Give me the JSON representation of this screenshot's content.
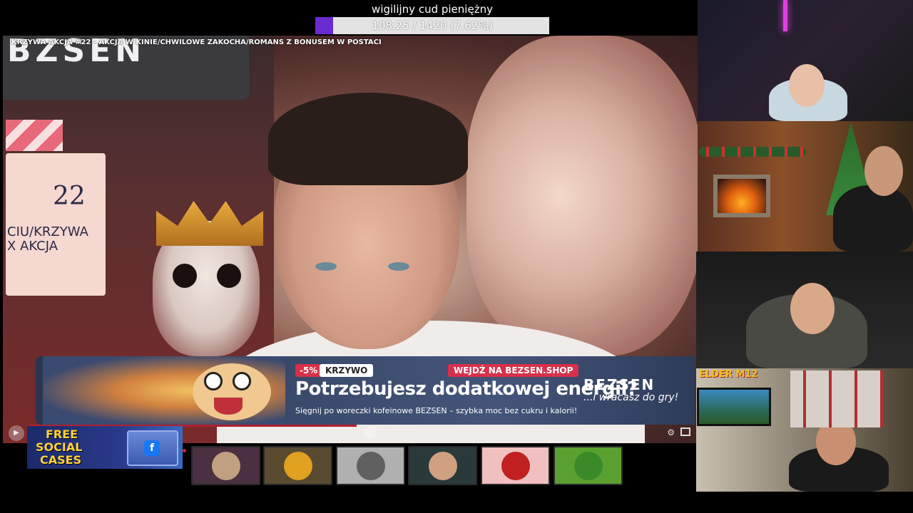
{
  "goal": {
    "title": "wigilijny cud pieniężny",
    "progress_text": "108.25 / 1420 (7.62%)",
    "fraction": 0.0762,
    "fill_color": "#6a2bd0"
  },
  "main_video": {
    "caption": "KRZYWA AKCJA #22 - AKCJA W KINIE/CHWILOWE ZAKOCHA/ROMANS Z BONUSEM W POSTACI",
    "logo_text": "BZSEN",
    "clapper_number": "22",
    "clapper_text_1": "CIU/KRZYWA",
    "clapper_text_2": "X AKCJA"
  },
  "ad": {
    "discount": "-5%",
    "brand_badge": "KRZYWO",
    "cta": "WEJDŹ NA BEZSEN.SHOP",
    "headline": "Potrzebujesz dodatkowej energii?",
    "subtext": "Sięgnij po woreczki kofeinowe BEZSEN – szybka moc bez cukru i kalorii!",
    "brand": "BEZSEN",
    "tagline": "...i wracasz do gry!"
  },
  "controls": {
    "play_icon": "play-icon",
    "chevron_icon": "chevron-up-icon",
    "progress_color": "#b02030"
  },
  "free_social_cases": {
    "line1": "FREE",
    "line2": "SOCIAL",
    "line3": "CASES",
    "fb_glyph": "f"
  },
  "emotes": [
    {
      "name": "emote-1",
      "bg": "#4a3040",
      "art": "#c0a080"
    },
    {
      "name": "emote-2",
      "bg": "#5a4a30",
      "art": "#e0a020"
    },
    {
      "name": "emote-3",
      "bg": "#b0b0b0",
      "art": "#606060"
    },
    {
      "name": "emote-4",
      "bg": "#2a3a3a",
      "art": "#d0a080"
    },
    {
      "name": "emote-5",
      "bg": "#f0c0c0",
      "art": "#c02020"
    },
    {
      "name": "emote-6",
      "bg": "#5aa030",
      "art": "#3a8a2a"
    }
  ],
  "cams": {
    "cam4_logo": "ELDER M12"
  }
}
